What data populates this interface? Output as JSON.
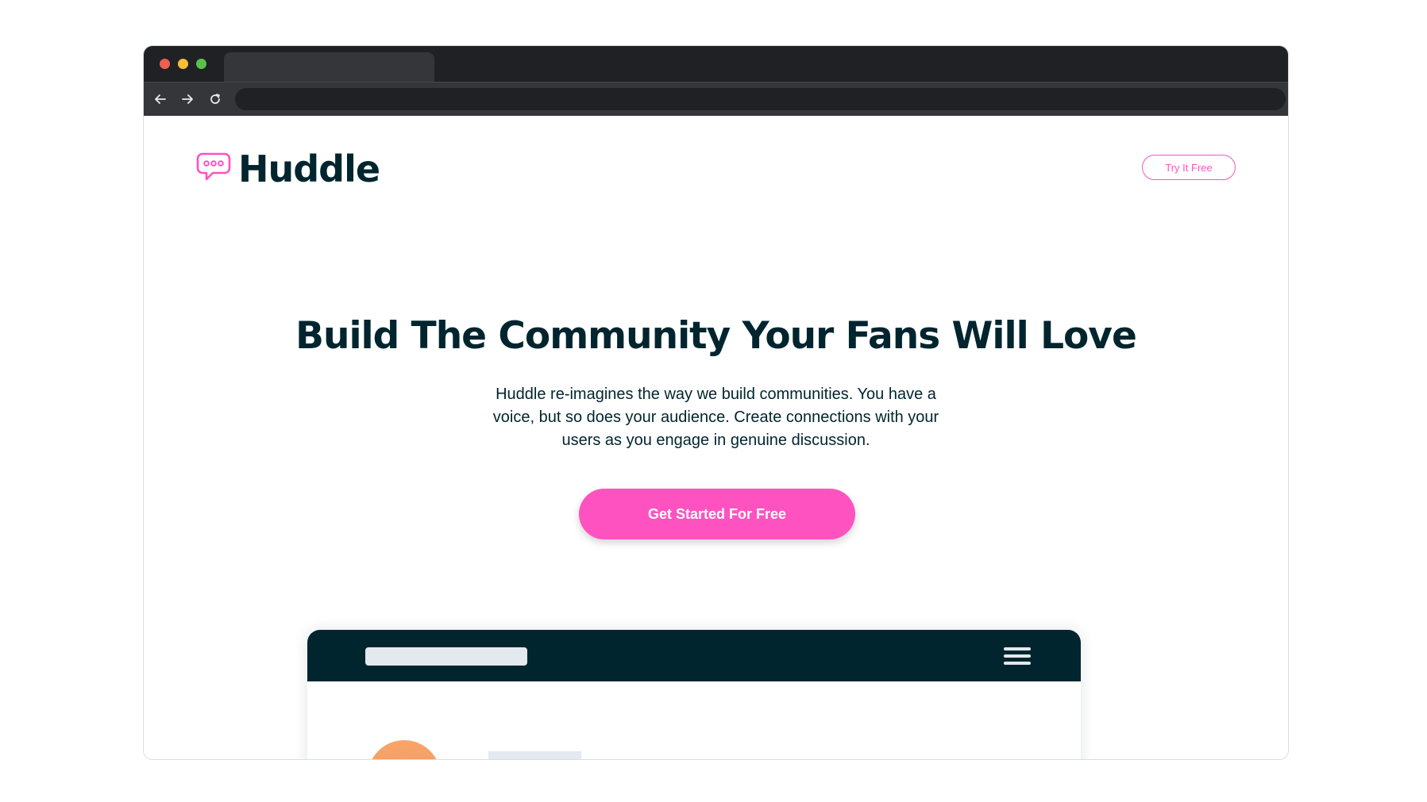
{
  "browser": {
    "tab_title": "",
    "url": ""
  },
  "header": {
    "logo_text": "Huddle",
    "try_button_label": "Try It Free"
  },
  "hero": {
    "headline": "Build The Community Your Fans Will Love",
    "description": "Huddle re-imagines the way we build communities. You have a voice, but so does your audience. Create connections with your users as you engage in genuine discussion.",
    "cta_label": "Get Started For Free"
  },
  "colors": {
    "brand_pink": "#ff52c1",
    "dark_cyan": "#00252e",
    "light_gray": "#e3e9ee"
  },
  "icons": {
    "logo": "speech-bubble-icon",
    "back": "arrow-left-icon",
    "forward": "arrow-right-icon",
    "reload": "reload-icon",
    "menu": "hamburger-menu-icon"
  }
}
